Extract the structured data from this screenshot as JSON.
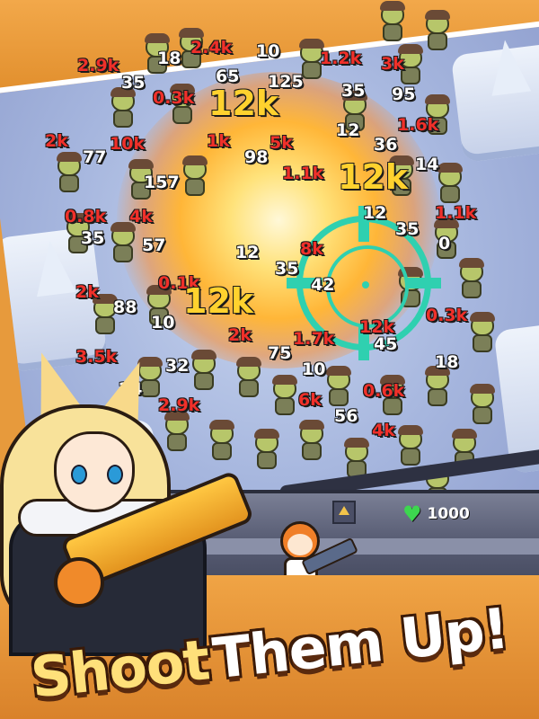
{
  "title": {
    "word1": "Shoot",
    "word2": "Them Up!"
  },
  "hud": {
    "hp_icon": "heart-icon",
    "hp_value": "1000"
  },
  "colors": {
    "frame": "#e79a3c",
    "damage_white": "#ffffff",
    "damage_red": "#f0302a",
    "damage_big": "#ffd22e",
    "crosshair": "#2fd0b0",
    "heart": "#3dd64f"
  },
  "damage_numbers": [
    {
      "text": "2.9k",
      "style": "red"
    },
    {
      "text": "18",
      "style": "white"
    },
    {
      "text": "2.4k",
      "style": "red"
    },
    {
      "text": "10",
      "style": "white"
    },
    {
      "text": "1.2k",
      "style": "red"
    },
    {
      "text": "3k",
      "style": "red"
    },
    {
      "text": "35",
      "style": "white"
    },
    {
      "text": "65",
      "style": "white"
    },
    {
      "text": "125",
      "style": "white"
    },
    {
      "text": "35",
      "style": "white"
    },
    {
      "text": "95",
      "style": "white"
    },
    {
      "text": "0.3k",
      "style": "red"
    },
    {
      "text": "12k",
      "style": "big"
    },
    {
      "text": "1.6k",
      "style": "red"
    },
    {
      "text": "12",
      "style": "white"
    },
    {
      "text": "2k",
      "style": "red"
    },
    {
      "text": "10k",
      "style": "red"
    },
    {
      "text": "1k",
      "style": "red"
    },
    {
      "text": "5k",
      "style": "red"
    },
    {
      "text": "36",
      "style": "white"
    },
    {
      "text": "77",
      "style": "white"
    },
    {
      "text": "98",
      "style": "white"
    },
    {
      "text": "1.1k",
      "style": "red"
    },
    {
      "text": "14",
      "style": "white"
    },
    {
      "text": "157",
      "style": "white"
    },
    {
      "text": "12k",
      "style": "big"
    },
    {
      "text": "0.8k",
      "style": "red"
    },
    {
      "text": "4k",
      "style": "red"
    },
    {
      "text": "12",
      "style": "white"
    },
    {
      "text": "1.1k",
      "style": "red"
    },
    {
      "text": "35",
      "style": "white"
    },
    {
      "text": "35",
      "style": "white"
    },
    {
      "text": "57",
      "style": "white"
    },
    {
      "text": "0",
      "style": "white"
    },
    {
      "text": "12",
      "style": "white"
    },
    {
      "text": "8k",
      "style": "red"
    },
    {
      "text": "2k",
      "style": "red"
    },
    {
      "text": "0.1k",
      "style": "red"
    },
    {
      "text": "35",
      "style": "white"
    },
    {
      "text": "42",
      "style": "white"
    },
    {
      "text": "88",
      "style": "white"
    },
    {
      "text": "12k",
      "style": "big"
    },
    {
      "text": "0.3k",
      "style": "red"
    },
    {
      "text": "10",
      "style": "white"
    },
    {
      "text": "2k",
      "style": "red"
    },
    {
      "text": "1.7k",
      "style": "red"
    },
    {
      "text": "12k",
      "style": "red"
    },
    {
      "text": "45",
      "style": "white"
    },
    {
      "text": "3.5k",
      "style": "red"
    },
    {
      "text": "75",
      "style": "white"
    },
    {
      "text": "18",
      "style": "white"
    },
    {
      "text": "32",
      "style": "white"
    },
    {
      "text": "10",
      "style": "white"
    },
    {
      "text": "0.6k",
      "style": "red"
    },
    {
      "text": "24",
      "style": "white"
    },
    {
      "text": "6k",
      "style": "red"
    },
    {
      "text": "2.9k",
      "style": "red"
    },
    {
      "text": "56",
      "style": "white"
    },
    {
      "text": "4k",
      "style": "red"
    }
  ]
}
